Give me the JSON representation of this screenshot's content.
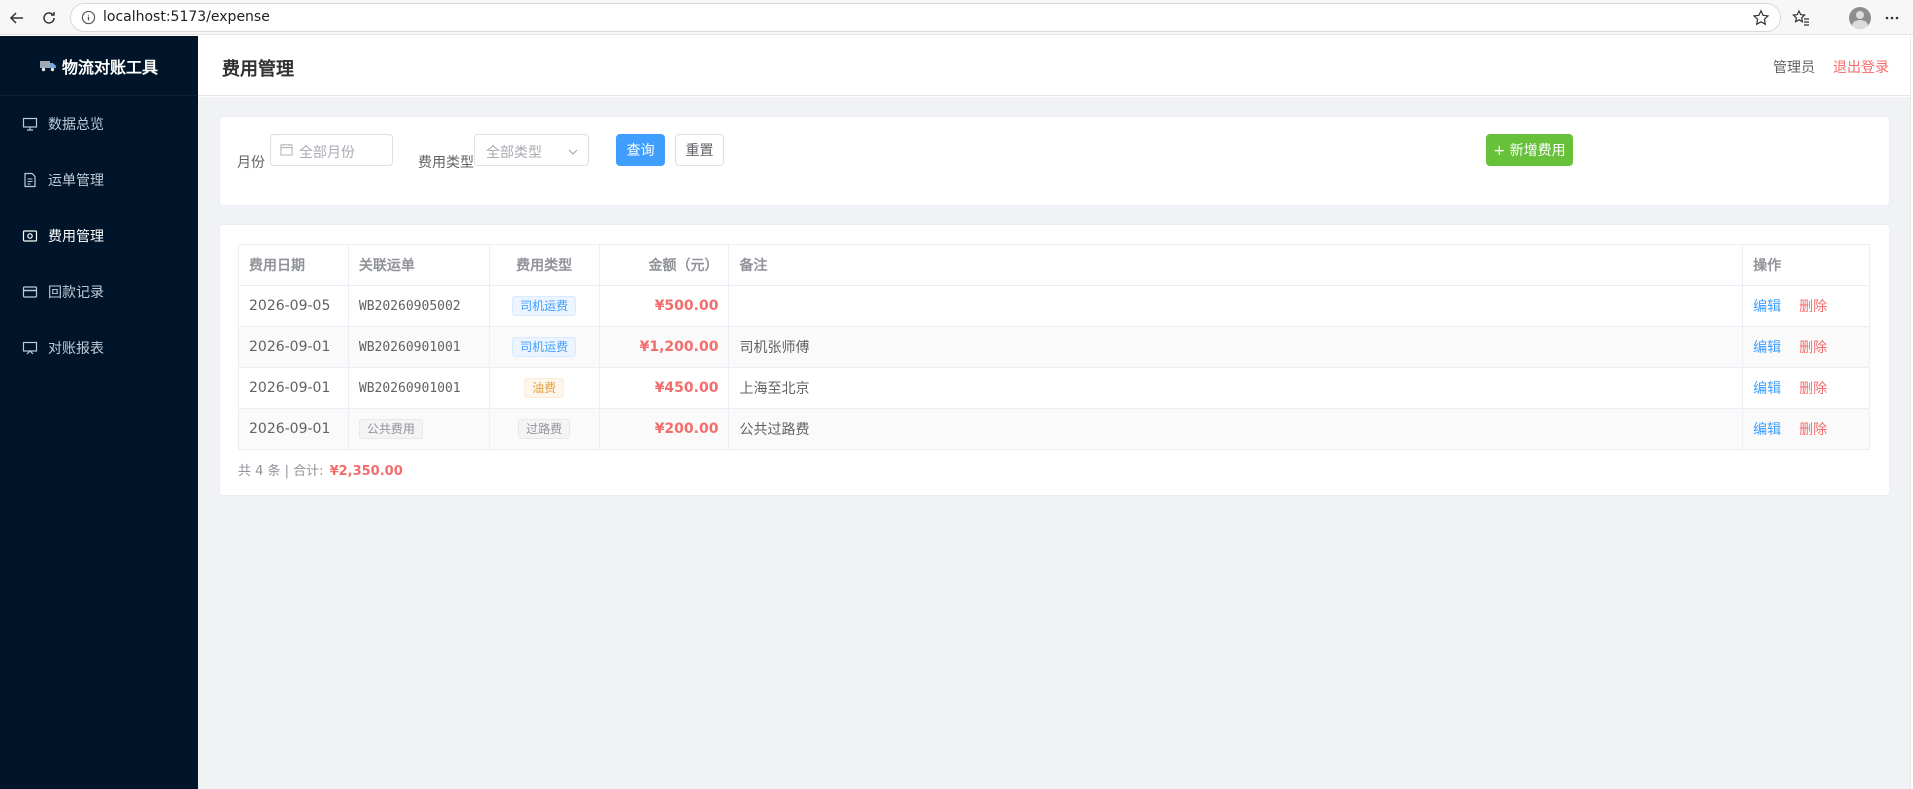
{
  "browser": {
    "url": "localhost:5173/expense"
  },
  "sidebar": {
    "logo_text": "物流对账工具",
    "items": [
      {
        "label": "数据总览",
        "icon": "monitor-icon"
      },
      {
        "label": "运单管理",
        "icon": "document-icon"
      },
      {
        "label": "费用管理",
        "icon": "wallet-icon",
        "active": true
      },
      {
        "label": "回款记录",
        "icon": "credit-card-icon"
      },
      {
        "label": "对账报表",
        "icon": "chart-board-icon"
      }
    ]
  },
  "header": {
    "title": "费用管理",
    "user": "管理员",
    "logout": "退出登录"
  },
  "filter": {
    "month_label": "月份",
    "month_placeholder": "全部月份",
    "type_label": "费用类型",
    "type_placeholder": "全部类型",
    "query_btn": "查询",
    "reset_btn": "重置",
    "add_btn": "+ 新增费用"
  },
  "table": {
    "headers": [
      "费用日期",
      "关联运单",
      "费用类型",
      "金额（元）",
      "备注",
      "操作"
    ],
    "rows": [
      {
        "date": "2026-09-05",
        "waybill": "WB20260905002",
        "type": "司机运费",
        "amount": "¥500.00",
        "remark": "",
        "edit": "编辑",
        "delete": "删除"
      },
      {
        "date": "2026-09-01",
        "waybill": "WB20260901001",
        "type": "司机运费",
        "amount": "¥1,200.00",
        "remark": "司机张师傅",
        "edit": "编辑",
        "delete": "删除"
      },
      {
        "date": "2026-09-01",
        "waybill": "WB20260901001",
        "type": "油费",
        "amount": "¥450.00",
        "remark": "上海至北京",
        "edit": "编辑",
        "delete": "删除"
      },
      {
        "date": "2026-09-01",
        "waybill": "公共费用",
        "type": "过路费",
        "amount": "¥200.00",
        "remark": "公共过路费",
        "edit": "编辑",
        "delete": "删除"
      }
    ]
  },
  "summary": {
    "count_text": "共 4 条 | 合计:",
    "total": "¥2,350.00"
  },
  "colors": {
    "sidebar_bg": "#001529",
    "primary": "#409eff",
    "success": "#67c23a",
    "danger": "#f56c6c",
    "warning": "#e6a23c"
  }
}
